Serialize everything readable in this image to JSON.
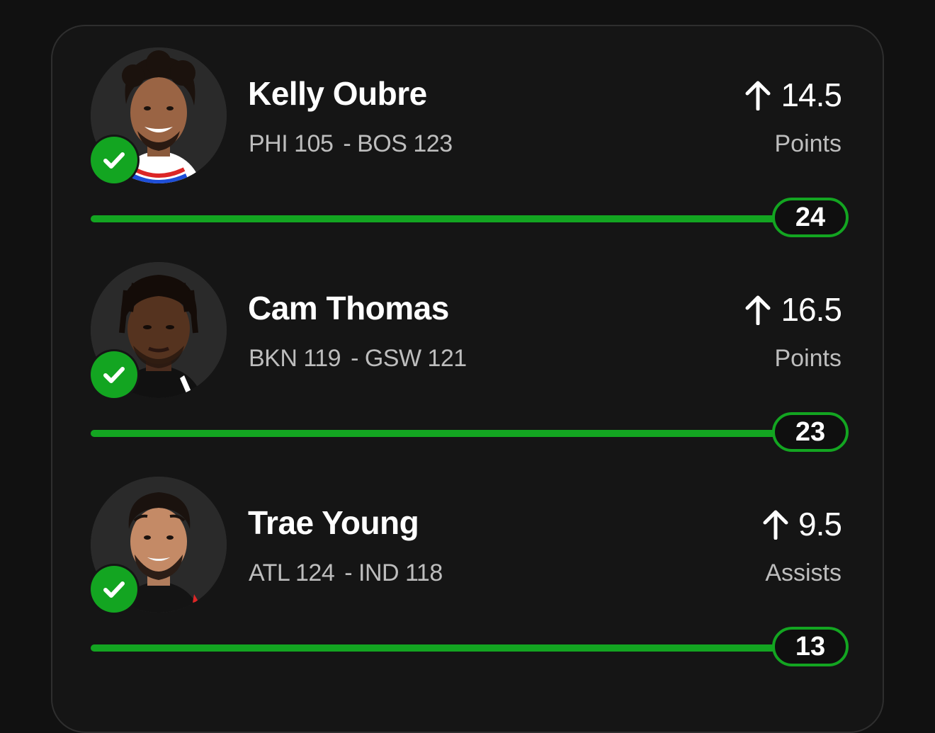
{
  "colors": {
    "background": "#111111",
    "card": "#151515",
    "accent_green": "#13a521",
    "muted_text": "#bdbdbd"
  },
  "picks": [
    {
      "player": "Kelly Oubre",
      "home_team": "PHI 105",
      "away_team": "- BOS 123",
      "line": "14.5",
      "direction_icon": "arrow-up-icon",
      "stat": "Points",
      "actual": "24",
      "progress": 1.0,
      "status_icon": "checkmark-icon"
    },
    {
      "player": "Cam Thomas",
      "home_team": "BKN 119",
      "away_team": "- GSW 121",
      "line": "16.5",
      "direction_icon": "arrow-up-icon",
      "stat": "Points",
      "actual": "23",
      "progress": 1.0,
      "status_icon": "checkmark-icon"
    },
    {
      "player": "Trae Young",
      "home_team": "ATL 124",
      "away_team": "- IND 118",
      "line": "9.5",
      "direction_icon": "arrow-up-icon",
      "stat": "Assists",
      "actual": "13",
      "progress": 1.0,
      "status_icon": "checkmark-icon"
    }
  ]
}
